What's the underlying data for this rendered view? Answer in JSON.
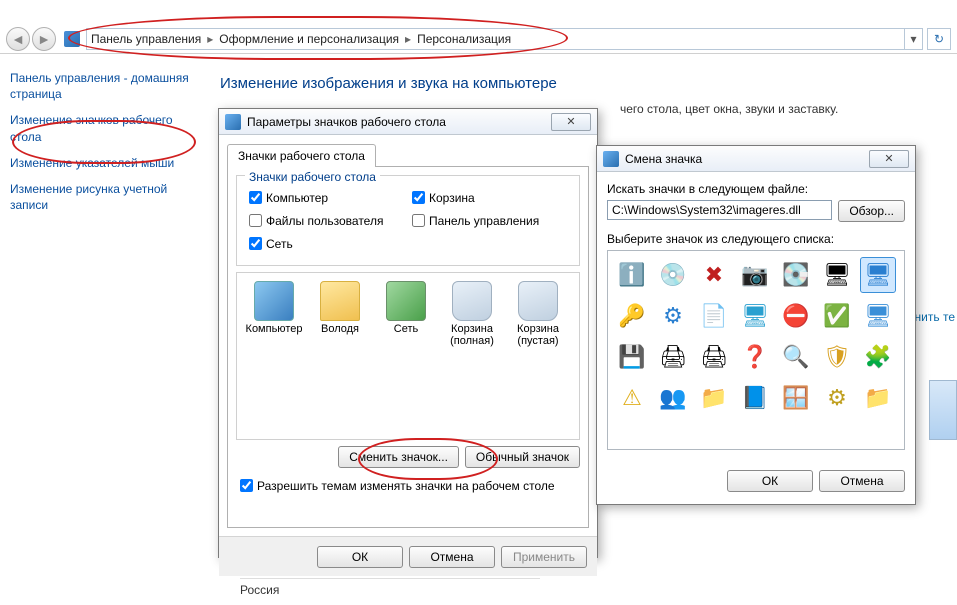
{
  "nav": {
    "crumbs": [
      "Панель управления",
      "Оформление и персонализация",
      "Персонализация"
    ]
  },
  "sidebar": {
    "home": "Панель управления - домашняя страница",
    "links": [
      "Изменение значков рабочего стола",
      "Изменение указателей мыши",
      "Изменение рисунка учетной записи"
    ]
  },
  "main": {
    "heading": "Изменение изображения и звука на компьютере",
    "sub_suffix": "чего стола, цвет окна, звуки и заставку.",
    "bottom": "Россия",
    "side_link": "нить те"
  },
  "dlg1": {
    "title": "Параметры значков рабочего стола",
    "tab": "Значки рабочего стола",
    "group_legend": "Значки рабочего стола",
    "chk_computer": "Компьютер",
    "chk_recycle": "Корзина",
    "chk_userfiles": "Файлы пользователя",
    "chk_cpanel": "Панель управления",
    "chk_network": "Сеть",
    "icons": {
      "computer": "Компьютер",
      "user": "Володя",
      "network": "Сеть",
      "bin_full": "Корзина (полная)",
      "bin_empty": "Корзина (пустая)"
    },
    "btn_change": "Сменить значок...",
    "btn_default": "Обычный значок",
    "allow_themes": "Разрешить темам изменять значки на рабочем столе",
    "ok": "ОК",
    "cancel": "Отмена",
    "apply": "Применить"
  },
  "dlg2": {
    "title": "Смена значка",
    "lbl_file": "Искать значки в следующем файле:",
    "file_value": "C:\\Windows\\System32\\imageres.dll",
    "browse": "Обзор...",
    "lbl_select": "Выберите значок из следующего списка:",
    "ok": "ОК",
    "cancel": "Отмена",
    "grid_icons": [
      {
        "g": "ℹ️",
        "n": "info-icon"
      },
      {
        "g": "💿",
        "n": "disc-icon"
      },
      {
        "g": "✖",
        "n": "red-x-icon",
        "c": "#c02020"
      },
      {
        "g": "📷",
        "n": "camera-icon"
      },
      {
        "g": "💽",
        "n": "drive-icon"
      },
      {
        "g": "🖥",
        "n": "monitor-dark-icon"
      },
      {
        "g": "🖥",
        "n": "monitor-selected-icon",
        "sel": true,
        "c": "#2a7fd0"
      },
      {
        "g": "🔑",
        "n": "key-icon",
        "c": "#d8a020"
      },
      {
        "g": "⚙",
        "n": "gear-blue-icon",
        "c": "#2a7fd0"
      },
      {
        "g": "📄",
        "n": "document-icon"
      },
      {
        "g": "🖥",
        "n": "display-icon",
        "c": "#2aa0d0"
      },
      {
        "g": "⛔",
        "n": "error-icon",
        "c": "#d03020"
      },
      {
        "g": "✅",
        "n": "check-icon",
        "c": "#2aa04a"
      },
      {
        "g": "🖥",
        "n": "screen-icon",
        "c": "#3a8fd8"
      },
      {
        "g": "💾",
        "n": "disk-icon"
      },
      {
        "g": "🖨",
        "n": "scanner-icon"
      },
      {
        "g": "🖨",
        "n": "printer-icon"
      },
      {
        "g": "❓",
        "n": "help-icon",
        "c": "#2a7fd0"
      },
      {
        "g": "🔍",
        "n": "search-folder-icon"
      },
      {
        "g": "🛡",
        "n": "shield-icon",
        "c": "#d8a020"
      },
      {
        "g": "🧩",
        "n": "puzzle-icon",
        "c": "#d04040"
      },
      {
        "g": "⚠",
        "n": "warning-icon",
        "c": "#e0b020"
      },
      {
        "g": "👥",
        "n": "users-icon"
      },
      {
        "g": "📁",
        "n": "folder-grey-icon"
      },
      {
        "g": "📘",
        "n": "book-icon",
        "c": "#3a6fb0"
      },
      {
        "g": "🪟",
        "n": "window-icon",
        "c": "#2a8fd0"
      },
      {
        "g": "⚙",
        "n": "gear-icon",
        "c": "#c0a020"
      },
      {
        "g": "📁",
        "n": "folder-icon",
        "c": "#f0c050"
      }
    ]
  }
}
